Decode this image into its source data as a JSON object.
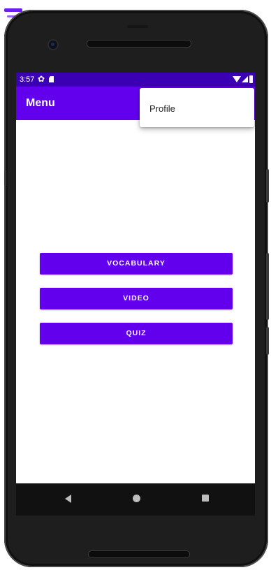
{
  "status_bar": {
    "time": "3:57",
    "icons": [
      "gear-icon",
      "sd-card-icon",
      "wifi-icon",
      "signal-icon",
      "battery-icon"
    ]
  },
  "app_bar": {
    "title": "Menu"
  },
  "overflow_menu": {
    "items": [
      {
        "label": "Profile"
      }
    ]
  },
  "main": {
    "buttons": [
      {
        "label": "VOCABULARY"
      },
      {
        "label": "VIDEO"
      },
      {
        "label": "QUIZ"
      }
    ]
  },
  "nav_bar": {
    "icons": [
      "back-icon",
      "home-icon",
      "recent-apps-icon"
    ]
  },
  "colors": {
    "primary": "#6200ee",
    "status_bar": "#3b00b3",
    "background": "#ffffff",
    "on_primary": "#ffffff"
  }
}
